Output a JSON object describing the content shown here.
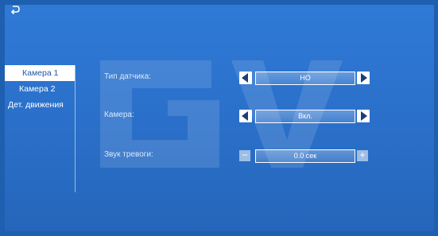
{
  "header": {
    "back_icon": "back-arrow-icon"
  },
  "sidebar": {
    "items": [
      {
        "label": "Камера 1"
      },
      {
        "label": "Камера 2"
      },
      {
        "label": "Дет. движения"
      }
    ],
    "selected_index": 0
  },
  "settings": {
    "sensor_type": {
      "label": "Тип датчика:",
      "value": "НО"
    },
    "camera": {
      "label": "Камера:",
      "value": "Вкл."
    },
    "alarm_sound": {
      "label": "Звук тревоги:",
      "value": "0.0 сек"
    }
  },
  "colors": {
    "background": "#2a6fc9",
    "accent": "#ffffff",
    "selected_text": "#1e57a5"
  }
}
